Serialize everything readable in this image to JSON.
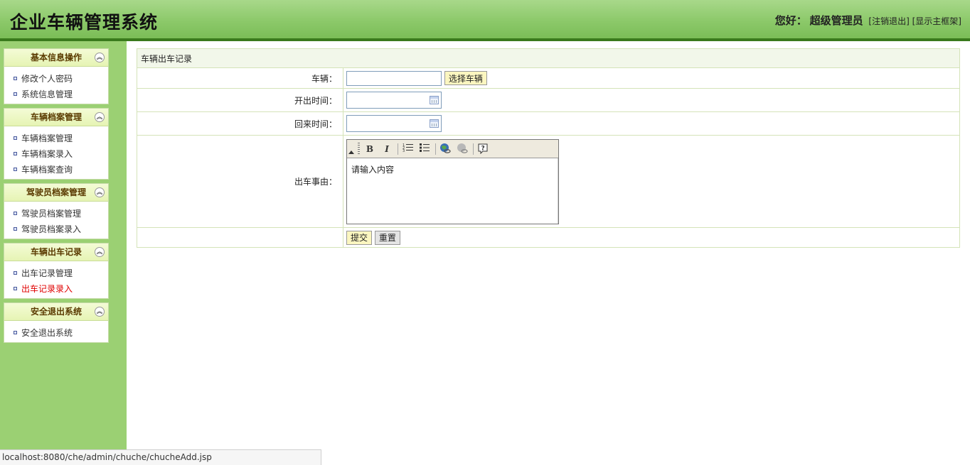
{
  "header": {
    "title": "企业车辆管理系统",
    "greeting": "您好：",
    "username": "超级管理员",
    "logout": "[注销退出]",
    "show_frame": "[显示主框架]"
  },
  "sidebar": {
    "groups": [
      {
        "title": "基本信息操作",
        "items": [
          "修改个人密码",
          "系统信息管理"
        ]
      },
      {
        "title": "车辆档案管理",
        "items": [
          "车辆档案管理",
          "车辆档案录入",
          "车辆档案查询"
        ]
      },
      {
        "title": "驾驶员档案管理",
        "items": [
          "驾驶员档案管理",
          "驾驶员档案录入"
        ]
      },
      {
        "title": "车辆出车记录",
        "items": [
          "出车记录管理",
          "出车记录录入"
        ]
      },
      {
        "title": "安全退出系统",
        "items": [
          "安全退出系统"
        ]
      }
    ],
    "active_item": "出车记录录入"
  },
  "form": {
    "title": "车辆出车记录",
    "vehicle_label": "车辆：",
    "vehicle_value": "",
    "select_vehicle_button": "选择车辆",
    "depart_label": "开出时间：",
    "depart_value": "",
    "return_label": "回来时间：",
    "return_value": "",
    "reason_label": "出车事由：",
    "reason_placeholder": "请输入内容",
    "submit_button": "提交",
    "reset_button": "重置"
  },
  "status_bar": {
    "url": "localhost:8080/che/admin/chuche/chucheAdd.jsp"
  },
  "colors": {
    "header_green": "#8cc96a",
    "sidebar_green": "#9bd073",
    "active_red": "#e00000"
  }
}
